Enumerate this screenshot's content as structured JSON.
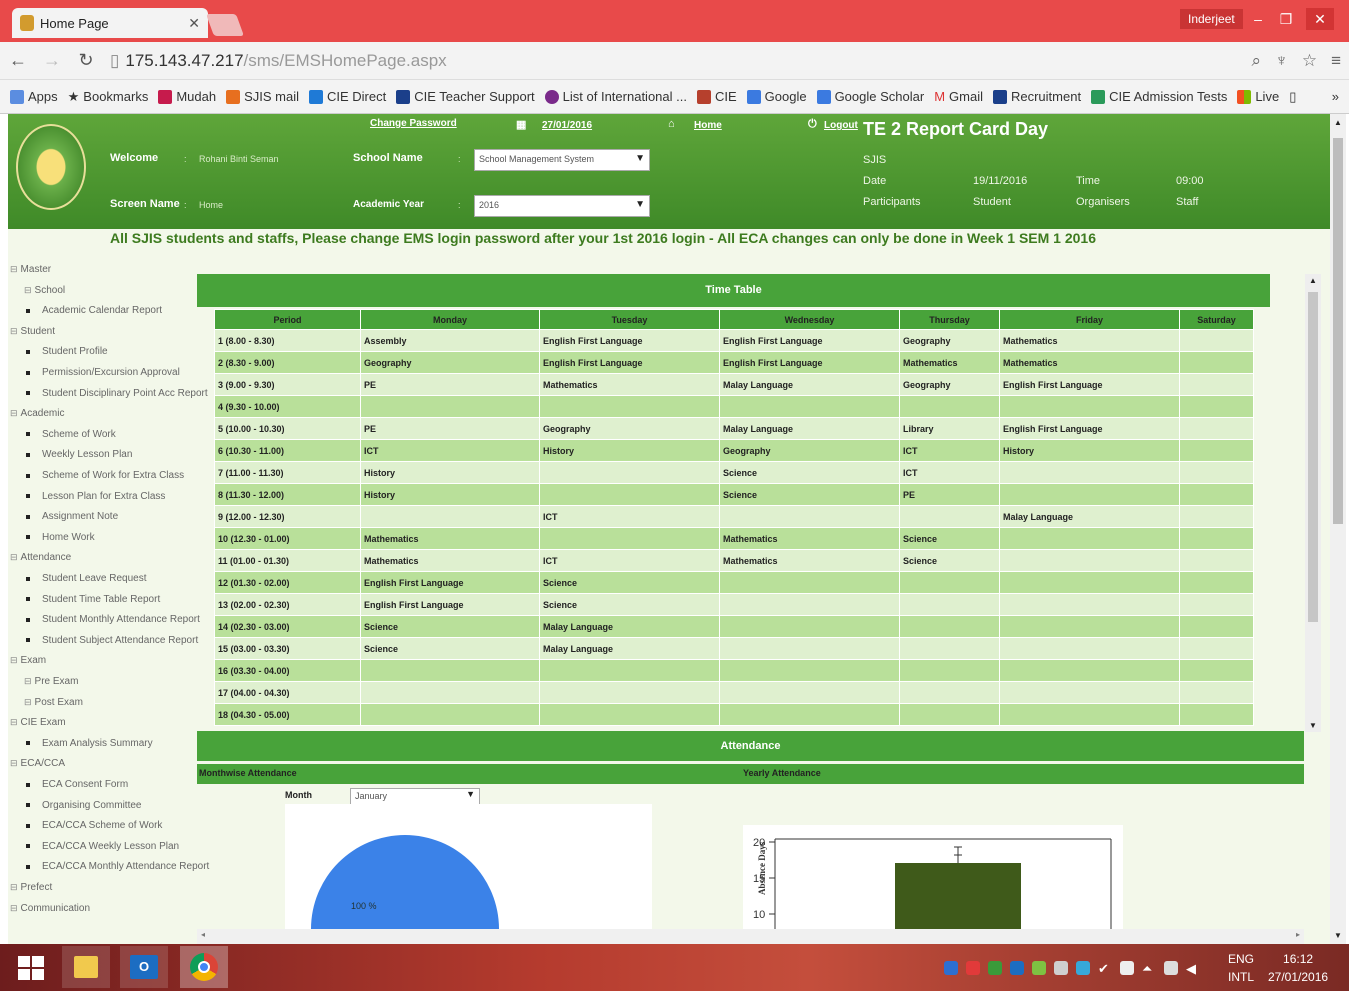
{
  "browser": {
    "tab_title": "Home Page",
    "user": "Inderjeet",
    "url_host": "175.143.47.217",
    "url_path": "/sms/EMSHomePage.aspx",
    "bookmarks": [
      "Apps",
      "Bookmarks",
      "Mudah",
      "SJIS mail",
      "CIE Direct",
      "CIE Teacher Support",
      "List of International ...",
      "CIE",
      "Google",
      "Google Scholar",
      "Gmail",
      "Recruitment",
      "CIE Admission Tests",
      "Live"
    ]
  },
  "header": {
    "change_password": "Change Password",
    "date": "27/01/2016",
    "home": "Home",
    "logout": "Logout",
    "welcome_label": "Welcome",
    "welcome_value": "Rohani Binti Seman",
    "school_label": "School Name",
    "school_value": "School Management System",
    "screen_label": "Screen Name",
    "screen_value": "Home",
    "year_label": "Academic Year",
    "year_value": "2016",
    "sep": ":"
  },
  "event": {
    "title": "TE 2 Report Card Day",
    "org": "SJIS",
    "date_label": "Date",
    "date_value": "19/11/2016",
    "time_label": "Time",
    "time_value": "09:00",
    "participants_label": "Participants",
    "participants_value": "Student",
    "organisers_label": "Organisers",
    "organisers_value": "Staff"
  },
  "announcement": "All SJIS students and staffs, Please change EMS login password after your 1st 2016 login - All ECA changes can only be done in Week 1 SEM 1 2016",
  "sidebar": [
    {
      "label": "Master",
      "level": 0
    },
    {
      "label": "School",
      "level": 1
    },
    {
      "label": "Academic Calendar Report",
      "level": 2
    },
    {
      "label": "Student",
      "level": 0
    },
    {
      "label": "Student Profile",
      "level": 2
    },
    {
      "label": "Permission/Excursion Approval",
      "level": 2
    },
    {
      "label": "Student Disciplinary Point Acc Report",
      "level": 2
    },
    {
      "label": "Academic",
      "level": 0
    },
    {
      "label": "Scheme of Work",
      "level": 2
    },
    {
      "label": "Weekly Lesson Plan",
      "level": 2
    },
    {
      "label": "Scheme of Work for Extra Class",
      "level": 2
    },
    {
      "label": "Lesson Plan for Extra Class",
      "level": 2
    },
    {
      "label": "Assignment Note",
      "level": 2
    },
    {
      "label": "Home Work",
      "level": 2
    },
    {
      "label": "Attendance",
      "level": 0
    },
    {
      "label": "Student Leave Request",
      "level": 2
    },
    {
      "label": "Student Time Table Report",
      "level": 2
    },
    {
      "label": "Student Monthly Attendance Report",
      "level": 2
    },
    {
      "label": "Student Subject Attendance Report",
      "level": 2
    },
    {
      "label": "Exam",
      "level": 0
    },
    {
      "label": "Pre Exam",
      "level": 1
    },
    {
      "label": "Post Exam",
      "level": 1
    },
    {
      "label": "CIE Exam",
      "level": 0
    },
    {
      "label": "Exam Analysis Summary",
      "level": 2
    },
    {
      "label": "ECA/CCA",
      "level": 0
    },
    {
      "label": "ECA Consent Form",
      "level": 2
    },
    {
      "label": "Organising Committee",
      "level": 2
    },
    {
      "label": "ECA/CCA Scheme of Work",
      "level": 2
    },
    {
      "label": "ECA/CCA Weekly Lesson Plan",
      "level": 2
    },
    {
      "label": "ECA/CCA Monthly Attendance Report",
      "level": 2
    },
    {
      "label": "Prefect",
      "level": 0
    },
    {
      "label": "Communication",
      "level": 0
    }
  ],
  "timetable": {
    "title": "Time Table",
    "columns": [
      "Period",
      "Monday",
      "Tuesday",
      "Wednesday",
      "Thursday",
      "Friday",
      "Saturday"
    ],
    "rows": [
      [
        "1 (8.00 - 8.30)",
        "Assembly",
        "English First Language",
        "English First Language",
        "Geography",
        "Mathematics",
        ""
      ],
      [
        "2 (8.30 - 9.00)",
        "Geography",
        "English First Language",
        "English First Language",
        "Mathematics",
        "Mathematics",
        ""
      ],
      [
        "3 (9.00 - 9.30)",
        "PE",
        "Mathematics",
        "Malay Language",
        "Geography",
        "English First Language",
        ""
      ],
      [
        "4 (9.30 - 10.00)",
        "",
        "",
        "",
        "",
        "",
        ""
      ],
      [
        "5 (10.00 - 10.30)",
        "PE",
        "Geography",
        "Malay Language",
        "Library",
        "English First Language",
        ""
      ],
      [
        "6 (10.30 - 11.00)",
        "ICT",
        "History",
        "Geography",
        "ICT",
        "History",
        ""
      ],
      [
        "7 (11.00 - 11.30)",
        "History",
        "",
        "Science",
        "ICT",
        "",
        ""
      ],
      [
        "8 (11.30 - 12.00)",
        "History",
        "",
        "Science",
        "PE",
        "",
        ""
      ],
      [
        "9 (12.00 - 12.30)",
        "",
        "ICT",
        "",
        "",
        "Malay Language",
        ""
      ],
      [
        "10 (12.30 - 01.00)",
        "Mathematics",
        "",
        "Mathematics",
        "Science",
        "",
        ""
      ],
      [
        "11 (01.00 - 01.30)",
        "Mathematics",
        "ICT",
        "Mathematics",
        "Science",
        "",
        ""
      ],
      [
        "12 (01.30 - 02.00)",
        "English First Language",
        "Science",
        "",
        "",
        "",
        ""
      ],
      [
        "13 (02.00 - 02.30)",
        "English First Language",
        "Science",
        "",
        "",
        "",
        ""
      ],
      [
        "14 (02.30 - 03.00)",
        "Science",
        "Malay Language",
        "",
        "",
        "",
        ""
      ],
      [
        "15 (03.00 - 03.30)",
        "Science",
        "Malay Language",
        "",
        "",
        "",
        ""
      ],
      [
        "16 (03.30 - 04.00)",
        "",
        "",
        "",
        "",
        "",
        ""
      ],
      [
        "17 (04.00 - 04.30)",
        "",
        "",
        "",
        "",
        "",
        ""
      ],
      [
        "18 (04.30 - 05.00)",
        "",
        "",
        "",
        "",
        "",
        ""
      ]
    ]
  },
  "attendance": {
    "title": "Attendance",
    "monthwise_label": "Monthwise Attendance",
    "yearly_label": "Yearly Attendance",
    "month_label": "Month",
    "month_value": "January",
    "pie_label": "100 %",
    "pie_color": "#3b82e8",
    "bar_ylabel": "Absence Days",
    "bar_ticks": [
      "20",
      "15",
      "10"
    ],
    "bar_color": "#3f5a1a"
  },
  "taskbar": {
    "lang1": "ENG",
    "lang2": "INTL",
    "time": "16:12",
    "date": "27/01/2016"
  },
  "colors": {
    "header_green": "#4f9a30",
    "table_header": "#48a33a",
    "row_light": "#dff0cf",
    "row_dark": "#b9e09a",
    "chrome_red": "#e84a4a"
  }
}
